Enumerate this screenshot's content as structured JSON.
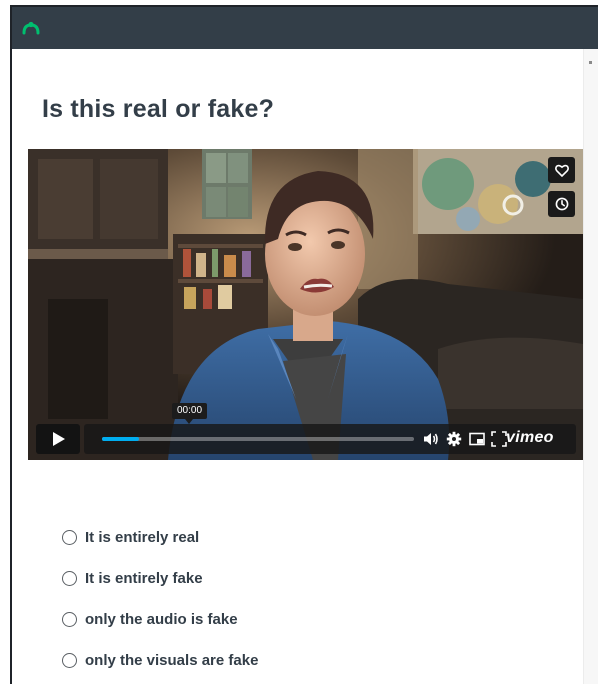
{
  "topbar": {
    "logo_icon": "surveymonkey-logo-icon",
    "background": "#333e48",
    "logo_color": "#00bf6f"
  },
  "question": {
    "title": "Is this real or fake?"
  },
  "video": {
    "time_tooltip": "00:00",
    "progress": 0.12,
    "brand": "vimeo",
    "side_actions": [
      "like-heart-icon",
      "watch-later-clock-icon"
    ],
    "control_icons": [
      "play-icon",
      "volume-icon",
      "settings-gear-icon",
      "picture-in-picture-icon",
      "fullscreen-icon"
    ],
    "accent_color": "#00adef"
  },
  "options": [
    {
      "label": "It is entirely real"
    },
    {
      "label": "It is entirely fake"
    },
    {
      "label": "only the audio is fake"
    },
    {
      "label": "only the visuals are fake"
    }
  ]
}
